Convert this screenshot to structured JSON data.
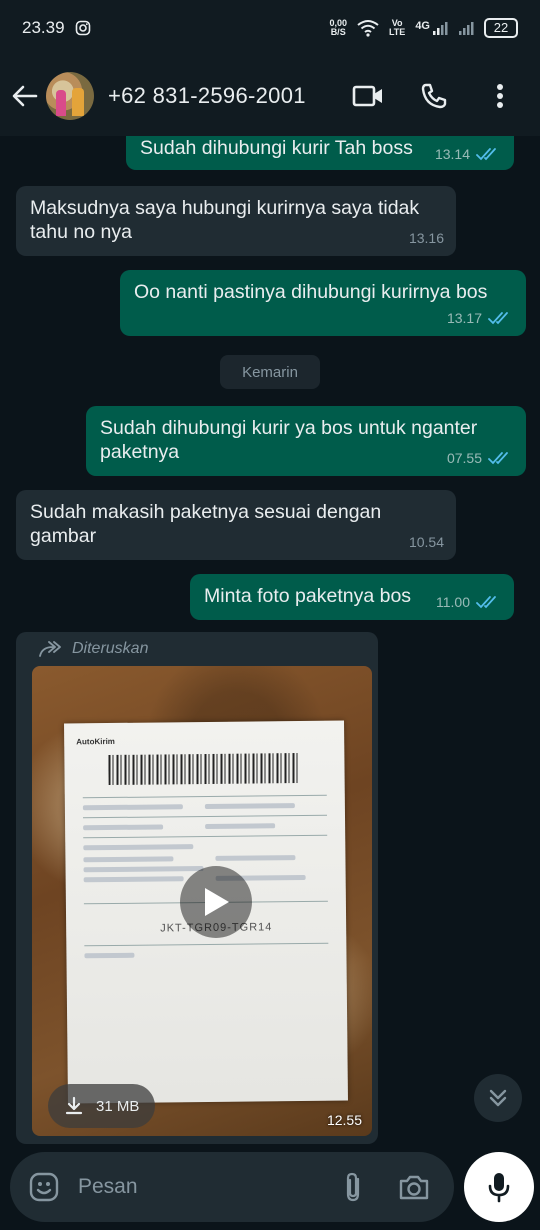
{
  "status_bar": {
    "time": "23.39",
    "net_speed_value": "0,00",
    "net_speed_unit": "B/S",
    "volte_top": "Vo",
    "volte_bottom": "LTE",
    "network": "4G",
    "battery": "22"
  },
  "header": {
    "contact": "+62 831-2596-2001"
  },
  "messages": [
    {
      "dir": "out",
      "text": "Sudah dihubungi kurir Tah boss",
      "time": "13.14",
      "read": true
    },
    {
      "dir": "in",
      "text": "Maksudnya saya hubungi kurirnya saya tidak tahu no nya",
      "time": "13.16"
    },
    {
      "dir": "out",
      "text": "Oo nanti pastinya dihubungi kurirnya bos",
      "time": "13.17",
      "read": true
    },
    {
      "dir": "out",
      "text": "Sudah dihubungi kurir ya bos untuk nganter paketnya",
      "time": "07.55",
      "read": true
    },
    {
      "dir": "in",
      "text": "Sudah makasih paketnya sesuai dengan gambar",
      "time": "10.54"
    },
    {
      "dir": "out",
      "text": "Minta foto paketnya bos",
      "time": "11.00",
      "read": true
    }
  ],
  "date_separator": "Kemarin",
  "media_message": {
    "forwarded_label": "Diteruskan",
    "file_size": "31 MB",
    "time": "12.55",
    "label_brand": "AutoKirim",
    "label_route": "JKT-TGR09-TGR14"
  },
  "composer": {
    "placeholder": "Pesan"
  },
  "colors": {
    "outgoing_bubble": "#005c4b",
    "incoming_bubble": "#202c33",
    "background": "#0b141a",
    "read_ticks": "#53bdeb"
  }
}
